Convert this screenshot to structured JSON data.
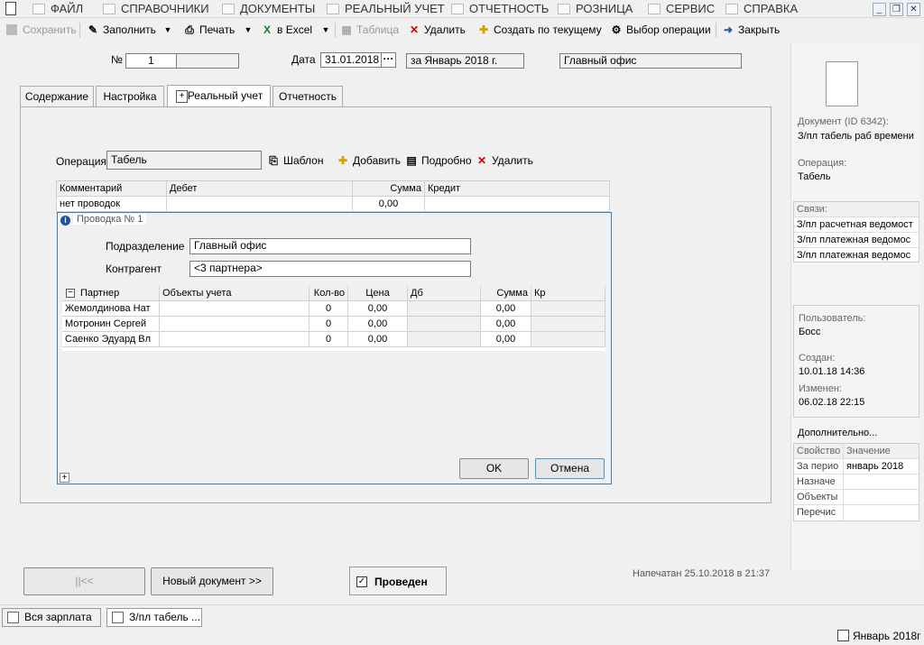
{
  "menu": {
    "items": [
      "ФАЙЛ",
      "СПРАВОЧНИКИ",
      "ДОКУМЕНТЫ",
      "РЕАЛЬНЫЙ УЧЕТ",
      "ОТЧЕТНОСТЬ",
      "РОЗНИЦА",
      "СЕРВИС",
      "СПРАВКА"
    ]
  },
  "toolbar": {
    "save": "Сохранить",
    "fill": "Заполнить",
    "print": "Печать",
    "excel": "в Excel",
    "table": "Таблица",
    "delete": "Удалить",
    "create_by_current": "Создать по текущему",
    "select_operation": "Выбор операции",
    "close": "Закрыть"
  },
  "header": {
    "number_label": "№",
    "number_value": "1",
    "date_label": "Дата",
    "date_value": "31.01.2018",
    "period_value": "за Январь 2018 г.",
    "office_value": "Главный офис"
  },
  "tabs": [
    "Содержание",
    "Настройка",
    "Реальный учет",
    "Отчетность"
  ],
  "operation": {
    "label": "Операция",
    "value": "Табель",
    "template": "Шаблон",
    "add": "Добавить",
    "details": "Подробно",
    "delete": "Удалить"
  },
  "entries_grid": {
    "headers": [
      "Комментарий",
      "Дебет",
      "Сумма",
      "Кредит"
    ],
    "row": {
      "comment": "нет проводок",
      "sum": "0,00"
    }
  },
  "dialog": {
    "title": "Проводка № 1",
    "department_label": "Подразделение",
    "department_value": "Главный офис",
    "contractor_label": "Контрагент",
    "contractor_value": "<3 партнера>",
    "columns": [
      "Партнер",
      "Объекты учета",
      "Кол-во",
      "Цена",
      "Дб",
      "Сумма",
      "Кр"
    ],
    "rows": [
      {
        "partner": "Жемолдинова Нат",
        "qty": "0",
        "price": "0,00",
        "sum": "0,00"
      },
      {
        "partner": "Мотронин Сергей",
        "qty": "0",
        "price": "0,00",
        "sum": "0,00"
      },
      {
        "partner": "Саенко Эдуард Вл",
        "qty": "0",
        "price": "0,00",
        "sum": "0,00"
      }
    ],
    "ok": "OK",
    "cancel": "Отмена"
  },
  "right_panel": {
    "document_label": "Документ  (ID 6342):",
    "document_value": "З/пл табель раб времени",
    "operation_label": "Операция:",
    "operation_value": "Табель",
    "links_label": "Связи:",
    "links": [
      "З/пл расчетная ведомост",
      "З/пл платежная ведомос",
      "З/пл платежная ведомос"
    ],
    "user_label": "Пользователь:",
    "user_value": "Босс",
    "created_label": "Создан:",
    "created_value": "10.01.18  14:36",
    "modified_label": "Изменен:",
    "modified_value": "06.02.18  22:15",
    "extra_label": "Дополнительно...",
    "prop_headers": [
      "Свойство",
      "Значение"
    ],
    "props": [
      {
        "name": "За перио",
        "value": "январь 2018"
      },
      {
        "name": "Назначе",
        "value": ""
      },
      {
        "name": "Объекты",
        "value": ""
      },
      {
        "name": "Перечис",
        "value": ""
      }
    ]
  },
  "footer": {
    "prev_button": "||<<",
    "new_doc_button": "Новый документ >>",
    "posted_label": "Проведен",
    "printed_text": "Напечатан 25.10.2018 в 21:37"
  },
  "taskbar": {
    "items": [
      "Вся зарплата",
      "З/пл табель ..."
    ],
    "period": "Январь 2018г"
  }
}
